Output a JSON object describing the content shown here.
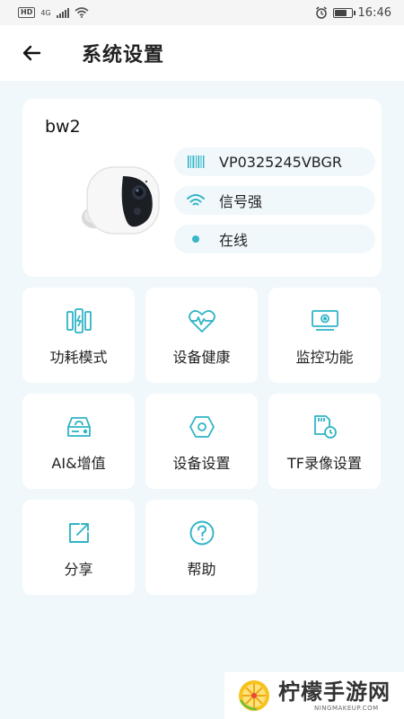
{
  "status_bar": {
    "network": "HD",
    "network_type": "4G",
    "time": "16:46",
    "battery_level": 0.75
  },
  "header": {
    "title": "系统设置",
    "back_icon": "arrow-left-icon"
  },
  "device": {
    "name": "bw2",
    "serial": "VP0325245VBGR",
    "signal": "信号强",
    "status": "在线",
    "colors": {
      "accent": "#2fb4c6",
      "status_dot": "#3bb5c8"
    }
  },
  "tiles": [
    {
      "label": "功耗模式",
      "icon": "power-mode-icon"
    },
    {
      "label": "设备健康",
      "icon": "heart-pulse-icon"
    },
    {
      "label": "监控功能",
      "icon": "monitor-icon"
    },
    {
      "label": "AI&增值",
      "icon": "cloud-storage-icon"
    },
    {
      "label": "设备设置",
      "icon": "settings-hex-icon"
    },
    {
      "label": "TF录像设置",
      "icon": "sd-card-icon"
    },
    {
      "label": "分享",
      "icon": "share-icon"
    },
    {
      "label": "帮助",
      "icon": "help-icon"
    }
  ],
  "watermark": {
    "title": "柠檬手游网",
    "subtitle": "NINGMAKEUP.COM"
  }
}
